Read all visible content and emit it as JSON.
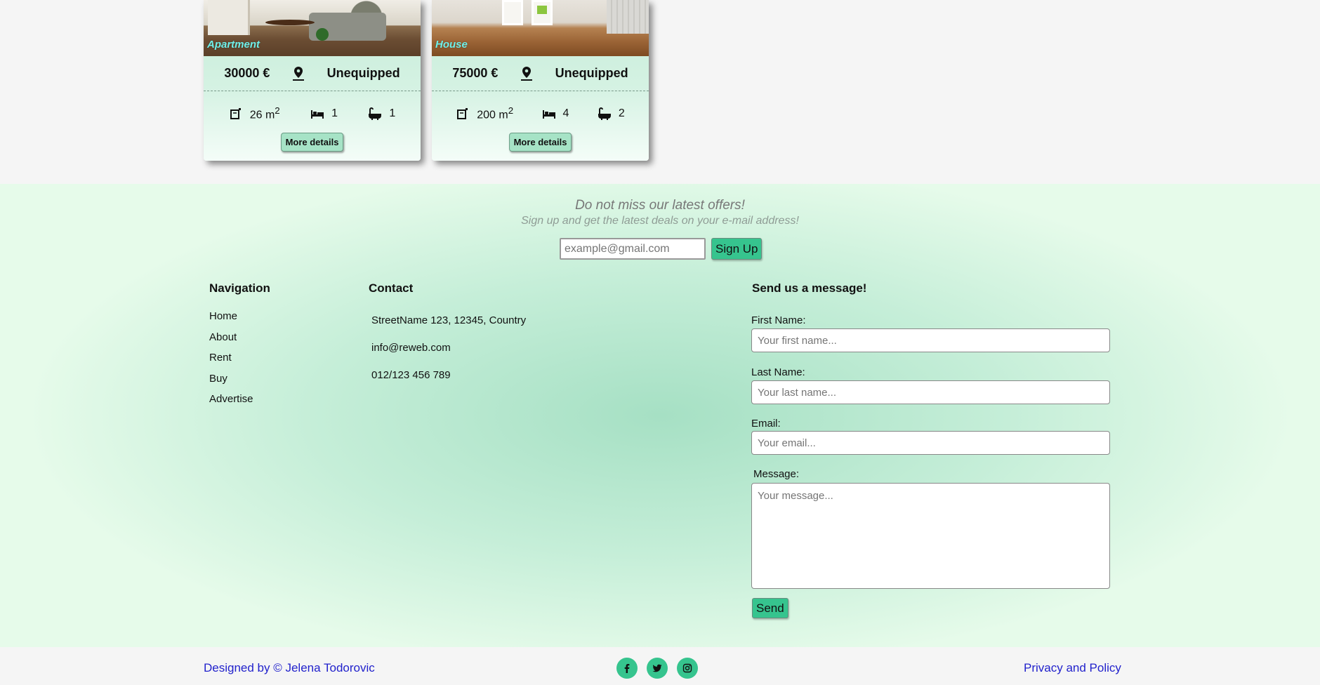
{
  "listings": [
    {
      "type": "Apartment",
      "price": "30000 €",
      "equipment": "Unequipped",
      "area": "26",
      "area_unit": "m",
      "area_sup": "2",
      "bedrooms": "1",
      "bathrooms": "1",
      "button": "More details"
    },
    {
      "type": "House",
      "price": "75000 €",
      "equipment": "Unequipped",
      "area": "200",
      "area_unit": "m",
      "area_sup": "2",
      "bedrooms": "4",
      "bathrooms": "2",
      "button": "More details"
    }
  ],
  "newsletter": {
    "title": "Do not miss our latest offers!",
    "subtitle": "Sign up and get the latest deals on your e-mail address!",
    "placeholder": "example@gmail.com",
    "button": "Sign Up"
  },
  "navigation": {
    "title": "Navigation",
    "items": [
      "Home",
      "About",
      "Rent",
      "Buy",
      "Advertise"
    ]
  },
  "contact": {
    "title": "Contact",
    "address": "StreetName 123, 12345, Country",
    "email": "info@reweb.com",
    "phone": "012/123 456 789"
  },
  "message_form": {
    "title": "Send us a message!",
    "first_name_label": "First Name:",
    "first_name_placeholder": "Your first name...",
    "last_name_label": "Last Name:",
    "last_name_placeholder": "Your last name...",
    "email_label": "Email:",
    "email_placeholder": "Your email...",
    "message_label": "Message:",
    "message_placeholder": "Your message...",
    "button": "Send"
  },
  "footer": {
    "credit": "Designed by © Jelena Todorovic",
    "privacy": "Privacy and Policy",
    "socials": [
      "facebook-icon",
      "twitter-icon",
      "instagram-icon"
    ]
  },
  "colors": {
    "accent": "#36c48e",
    "card_gradient_top": "#c4ecd7",
    "link": "#2222cc",
    "type_label": "#6ef0ea"
  }
}
